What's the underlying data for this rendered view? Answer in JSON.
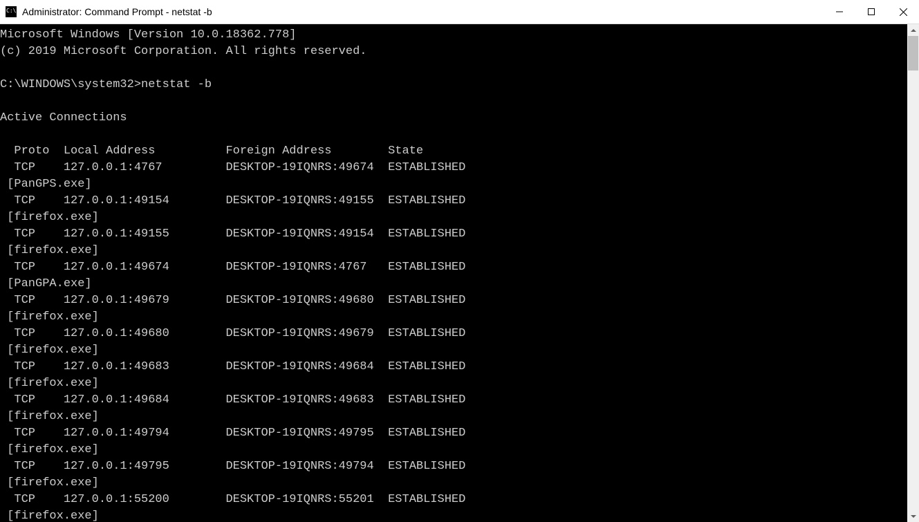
{
  "window": {
    "title": "Administrator: Command Prompt - netstat  -b"
  },
  "terminal": {
    "banner_line1": "Microsoft Windows [Version 10.0.18362.778]",
    "banner_line2": "(c) 2019 Microsoft Corporation. All rights reserved.",
    "prompt_path": "C:\\WINDOWS\\system32>",
    "command": "netstat -b",
    "section_header": "Active Connections",
    "columns": {
      "proto": "Proto",
      "local": "Local Address",
      "foreign": "Foreign Address",
      "state": "State"
    },
    "rows": [
      {
        "proto": "TCP",
        "local": "127.0.0.1:4767",
        "foreign": "DESKTOP-19IQNRS:49674",
        "state": "ESTABLISHED",
        "owner": "[PanGPS.exe]"
      },
      {
        "proto": "TCP",
        "local": "127.0.0.1:49154",
        "foreign": "DESKTOP-19IQNRS:49155",
        "state": "ESTABLISHED",
        "owner": "[firefox.exe]"
      },
      {
        "proto": "TCP",
        "local": "127.0.0.1:49155",
        "foreign": "DESKTOP-19IQNRS:49154",
        "state": "ESTABLISHED",
        "owner": "[firefox.exe]"
      },
      {
        "proto": "TCP",
        "local": "127.0.0.1:49674",
        "foreign": "DESKTOP-19IQNRS:4767",
        "state": "ESTABLISHED",
        "owner": "[PanGPA.exe]"
      },
      {
        "proto": "TCP",
        "local": "127.0.0.1:49679",
        "foreign": "DESKTOP-19IQNRS:49680",
        "state": "ESTABLISHED",
        "owner": "[firefox.exe]"
      },
      {
        "proto": "TCP",
        "local": "127.0.0.1:49680",
        "foreign": "DESKTOP-19IQNRS:49679",
        "state": "ESTABLISHED",
        "owner": "[firefox.exe]"
      },
      {
        "proto": "TCP",
        "local": "127.0.0.1:49683",
        "foreign": "DESKTOP-19IQNRS:49684",
        "state": "ESTABLISHED",
        "owner": "[firefox.exe]"
      },
      {
        "proto": "TCP",
        "local": "127.0.0.1:49684",
        "foreign": "DESKTOP-19IQNRS:49683",
        "state": "ESTABLISHED",
        "owner": "[firefox.exe]"
      },
      {
        "proto": "TCP",
        "local": "127.0.0.1:49794",
        "foreign": "DESKTOP-19IQNRS:49795",
        "state": "ESTABLISHED",
        "owner": "[firefox.exe]"
      },
      {
        "proto": "TCP",
        "local": "127.0.0.1:49795",
        "foreign": "DESKTOP-19IQNRS:49794",
        "state": "ESTABLISHED",
        "owner": "[firefox.exe]"
      },
      {
        "proto": "TCP",
        "local": "127.0.0.1:55200",
        "foreign": "DESKTOP-19IQNRS:55201",
        "state": "ESTABLISHED",
        "owner": "[firefox.exe]"
      }
    ]
  }
}
